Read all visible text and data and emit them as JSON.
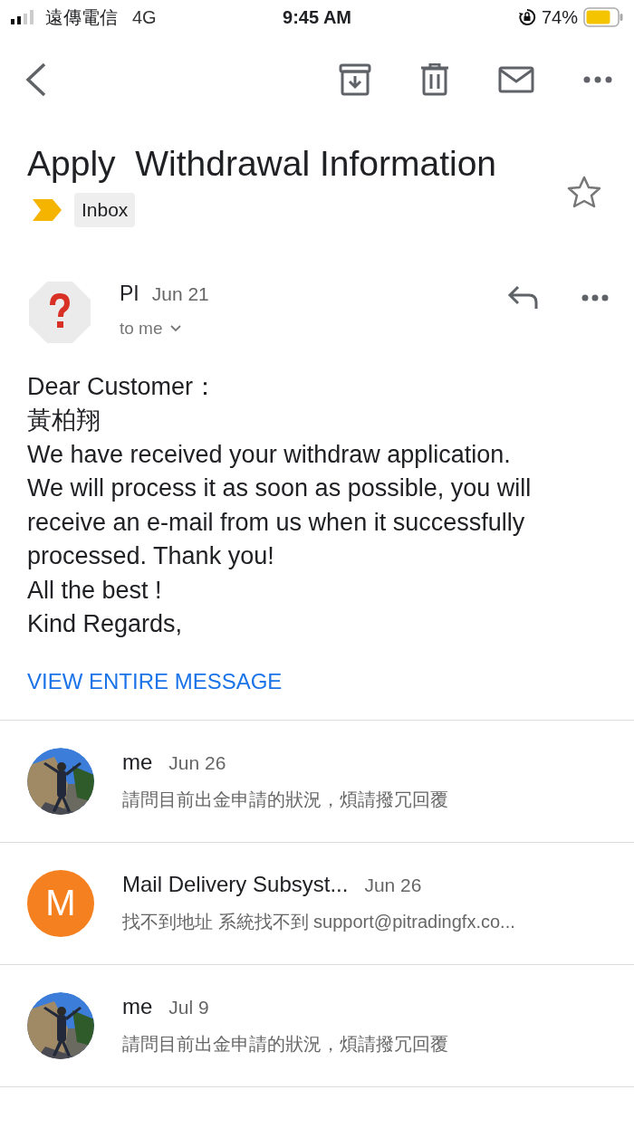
{
  "status_bar": {
    "carrier": "遠傳電信",
    "network": "4G",
    "time": "9:45 AM",
    "battery": "74%"
  },
  "email": {
    "subject": "Apply  Withdrawal Information",
    "label": "Inbox",
    "starred": false
  },
  "message": {
    "sender": "PI",
    "date": "Jun 21",
    "recipient": "to me",
    "avatar": {
      "kind": "unknown"
    },
    "body": [
      "Dear Customer：",
      "黃柏翔",
      "We have received your withdraw application.",
      "We will process it as soon as possible, you will",
      "receive an e-mail from us when it successfully",
      "processed. Thank you!",
      "All the best !",
      "Kind Regards,"
    ],
    "link": "VIEW ENTIRE MESSAGE"
  },
  "thread": [
    {
      "sender": "me",
      "date": "Jun 26",
      "snippet": "請問目前出金申請的狀況，煩請撥冗回覆"
    },
    {
      "sender": "Mail Delivery Subsyst...",
      "date": "Jun 26",
      "snippet": "找不到地址 系統找不到 support@pitradingfx.co...",
      "avatar": {
        "kind": "letter",
        "letter": "M",
        "color": "#f4801f"
      }
    },
    {
      "sender": "me",
      "date": "Jul 9",
      "snippet": "請問目前出金申請的狀況，煩請撥冗回覆"
    }
  ]
}
